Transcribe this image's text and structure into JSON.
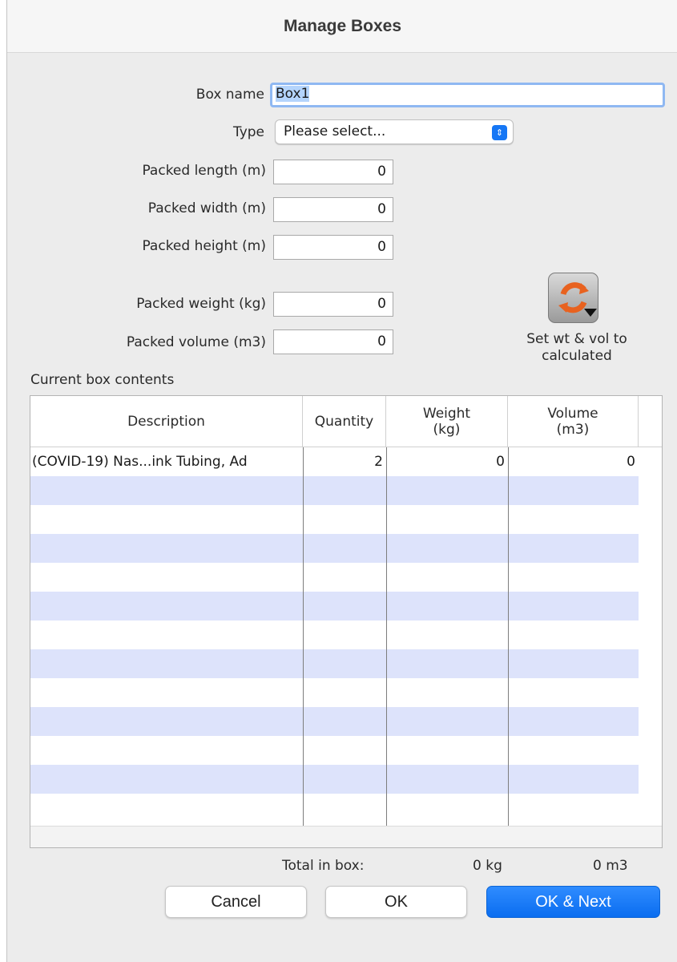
{
  "window": {
    "title": "Manage Boxes"
  },
  "form": {
    "box_name_label": "Box name",
    "box_name_value": "Box1",
    "type_label": "Type",
    "type_value": "Please select...",
    "packed_length_label": "Packed length (m)",
    "packed_length_value": "0",
    "packed_width_label": "Packed width (m)",
    "packed_width_value": "0",
    "packed_height_label": "Packed height (m)",
    "packed_height_value": "0",
    "packed_weight_label": "Packed weight (kg)",
    "packed_weight_value": "0",
    "packed_volume_label": "Packed volume (m3)",
    "packed_volume_value": "0"
  },
  "calc_button": {
    "caption_line1": "Set wt & vol to",
    "caption_line2": "calculated",
    "icon": "refresh-dropdown-icon"
  },
  "contents": {
    "section_label": "Current box contents",
    "columns": {
      "description": "Description",
      "quantity": "Quantity",
      "weight_1": "Weight",
      "weight_2": "(kg)",
      "volume_1": "Volume",
      "volume_2": "(m3)"
    },
    "rows": [
      {
        "description": "(COVID-19) Nas...ink Tubing, Ad",
        "quantity": "2",
        "weight": "0",
        "volume": "0"
      }
    ],
    "row_alt_color": "#dde3fb"
  },
  "totals": {
    "label": "Total in box:",
    "weight": "0 kg",
    "volume": "0  m3"
  },
  "buttons": {
    "cancel": "Cancel",
    "ok": "OK",
    "ok_next": "OK & Next",
    "primary_color": "#1677f5"
  }
}
